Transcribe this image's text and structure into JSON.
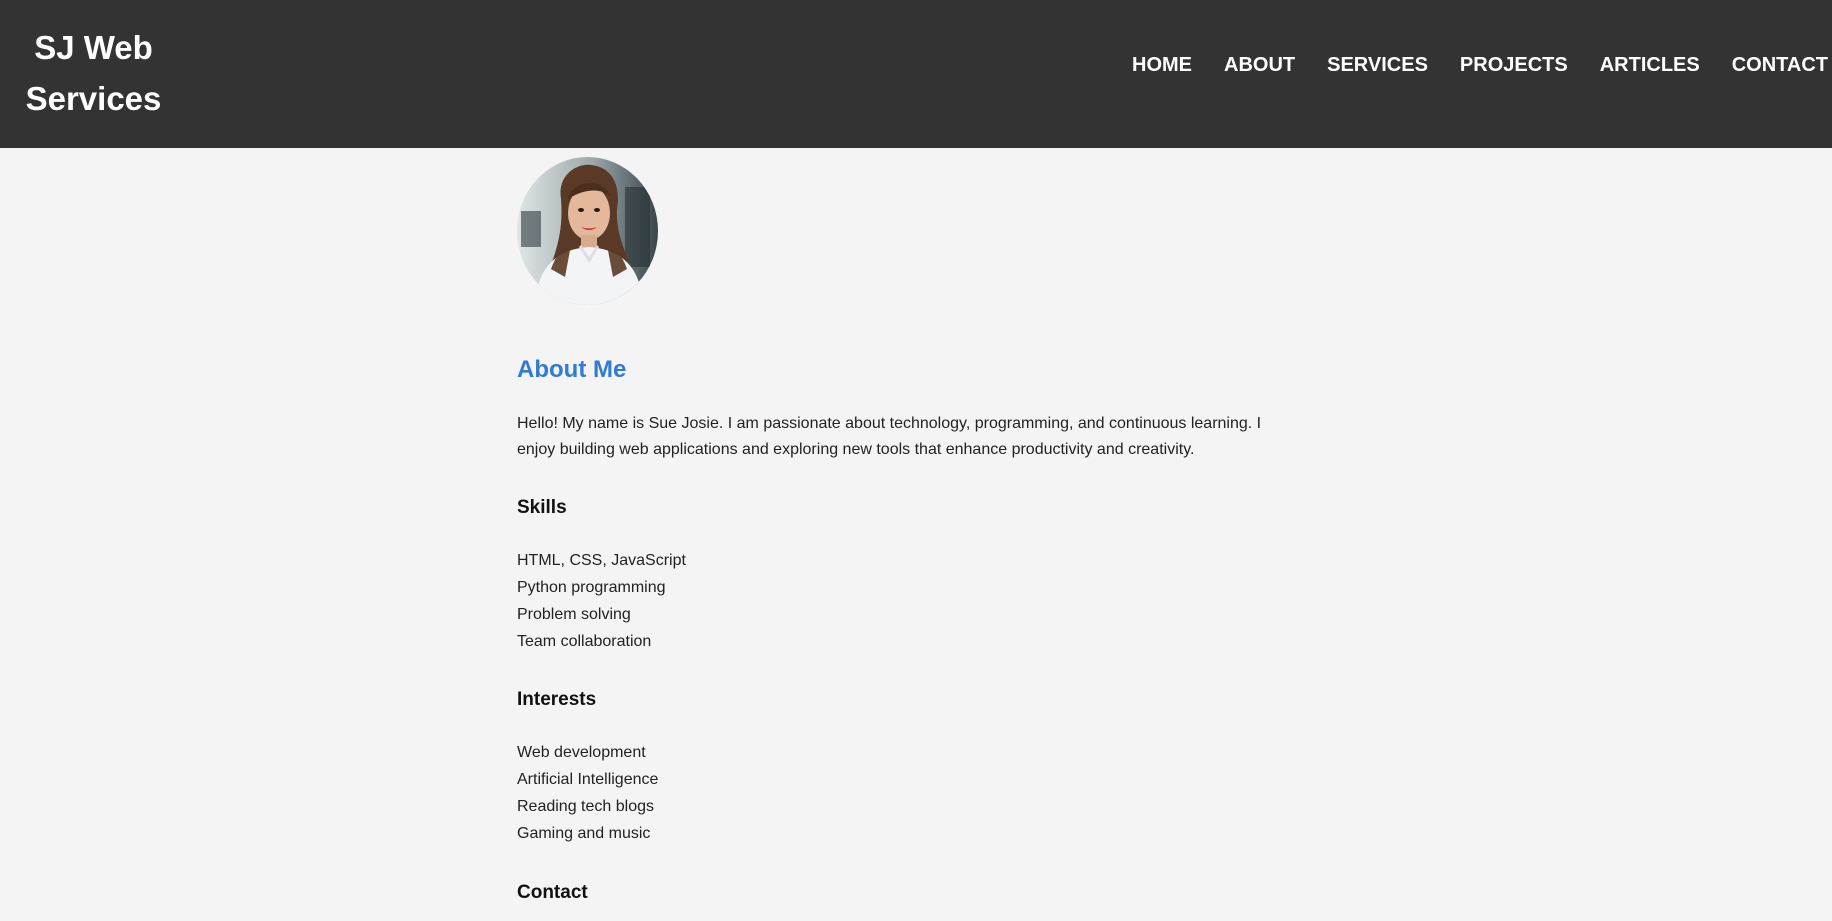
{
  "header": {
    "brand_line1": "SJ Web",
    "brand_line2": "Services",
    "nav": [
      {
        "label": "HOME"
      },
      {
        "label": "ABOUT"
      },
      {
        "label": "SERVICES"
      },
      {
        "label": "PROJECTS"
      },
      {
        "label": "ARTICLES"
      },
      {
        "label": "CONTACT"
      }
    ]
  },
  "colors": {
    "header_bg": "#333333",
    "page_bg": "#f4f4f4",
    "accent": "#2f7bd5"
  },
  "about": {
    "avatar_alt": "profile-photo",
    "title": "About Me",
    "intro": "Hello! My name is Sue Josie. I am passionate about technology, programming, and continuous learning. I enjoy building web applications and exploring new tools that enhance productivity and creativity.",
    "skills_heading": "Skills",
    "skills": [
      "HTML, CSS, JavaScript",
      "Python programming",
      "Problem solving",
      "Team collaboration"
    ],
    "interests_heading": "Interests",
    "interests": [
      "Web development",
      "Artificial Intelligence",
      "Reading tech blogs",
      "Gaming and music"
    ],
    "contact_heading": "Contact"
  }
}
